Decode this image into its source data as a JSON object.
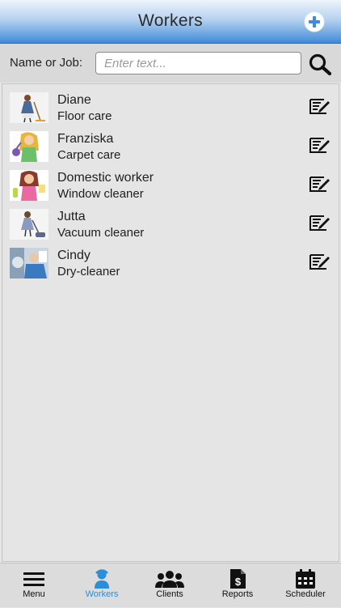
{
  "header": {
    "title": "Workers",
    "add_icon": "plus-circle-icon"
  },
  "search": {
    "label": "Name or Job:",
    "placeholder": "Enter text...",
    "value": ""
  },
  "workers": [
    {
      "name": "Diane",
      "job": "Floor care"
    },
    {
      "name": "Franziska",
      "job": "Carpet care"
    },
    {
      "name": "Domestic worker",
      "job": "Window cleaner"
    },
    {
      "name": "Jutta",
      "job": "Vacuum cleaner"
    },
    {
      "name": "Cindy",
      "job": "Dry-cleaner"
    }
  ],
  "tabs": [
    {
      "label": "Menu",
      "icon": "hamburger-icon"
    },
    {
      "label": "Workers",
      "icon": "worker-icon",
      "active": true
    },
    {
      "label": "Clients",
      "icon": "group-icon"
    },
    {
      "label": "Reports",
      "icon": "report-dollar-icon"
    },
    {
      "label": "Scheduler",
      "icon": "calendar-icon"
    }
  ],
  "colors": {
    "accent": "#2a8fd8",
    "header_dark": "#3f8ad9"
  }
}
